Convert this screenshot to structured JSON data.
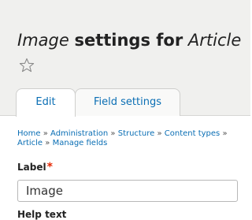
{
  "header": {
    "title_part1": "Image",
    "title_part2": "settings for",
    "title_part3": "Article",
    "star_icon": "star-outline-icon"
  },
  "tabs": [
    {
      "label": "Edit",
      "active": true
    },
    {
      "label": "Field settings",
      "active": false
    }
  ],
  "breadcrumb": {
    "items": [
      "Home",
      "Administration",
      "Structure",
      "Content types",
      "Article",
      "Manage fields"
    ],
    "separator": "»"
  },
  "form": {
    "label_field": {
      "label": "Label",
      "required_marker": "*",
      "value": "Image"
    },
    "help_text": {
      "label": "Help text"
    }
  },
  "colors": {
    "link": "#0a6eb4",
    "required": "#e62600",
    "header_bg": "#f0f0ee"
  }
}
